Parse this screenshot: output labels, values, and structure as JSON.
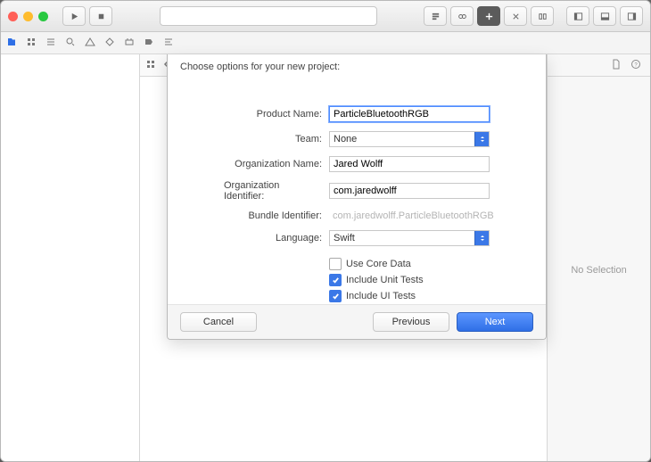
{
  "toolbar": {
    "search_placeholder": ""
  },
  "inspector": {
    "empty_text": "No Selection"
  },
  "sheet": {
    "title": "Choose options for your new project:",
    "labels": {
      "product_name": "Product Name:",
      "team": "Team:",
      "org_name": "Organization Name:",
      "org_ident": "Organization Identifier:",
      "bundle_ident": "Bundle Identifier:",
      "language": "Language:"
    },
    "values": {
      "product_name": "ParticleBluetoothRGB",
      "team": "None",
      "org_name": "Jared Wolff",
      "org_ident": "com.jaredwolff",
      "bundle_ident": "com.jaredwolff.ParticleBluetoothRGB",
      "language": "Swift"
    },
    "checks": {
      "core_data": {
        "label": "Use Core Data",
        "checked": false
      },
      "unit_tests": {
        "label": "Include Unit Tests",
        "checked": true
      },
      "ui_tests": {
        "label": "Include UI Tests",
        "checked": true
      }
    },
    "buttons": {
      "cancel": "Cancel",
      "previous": "Previous",
      "next": "Next"
    }
  }
}
